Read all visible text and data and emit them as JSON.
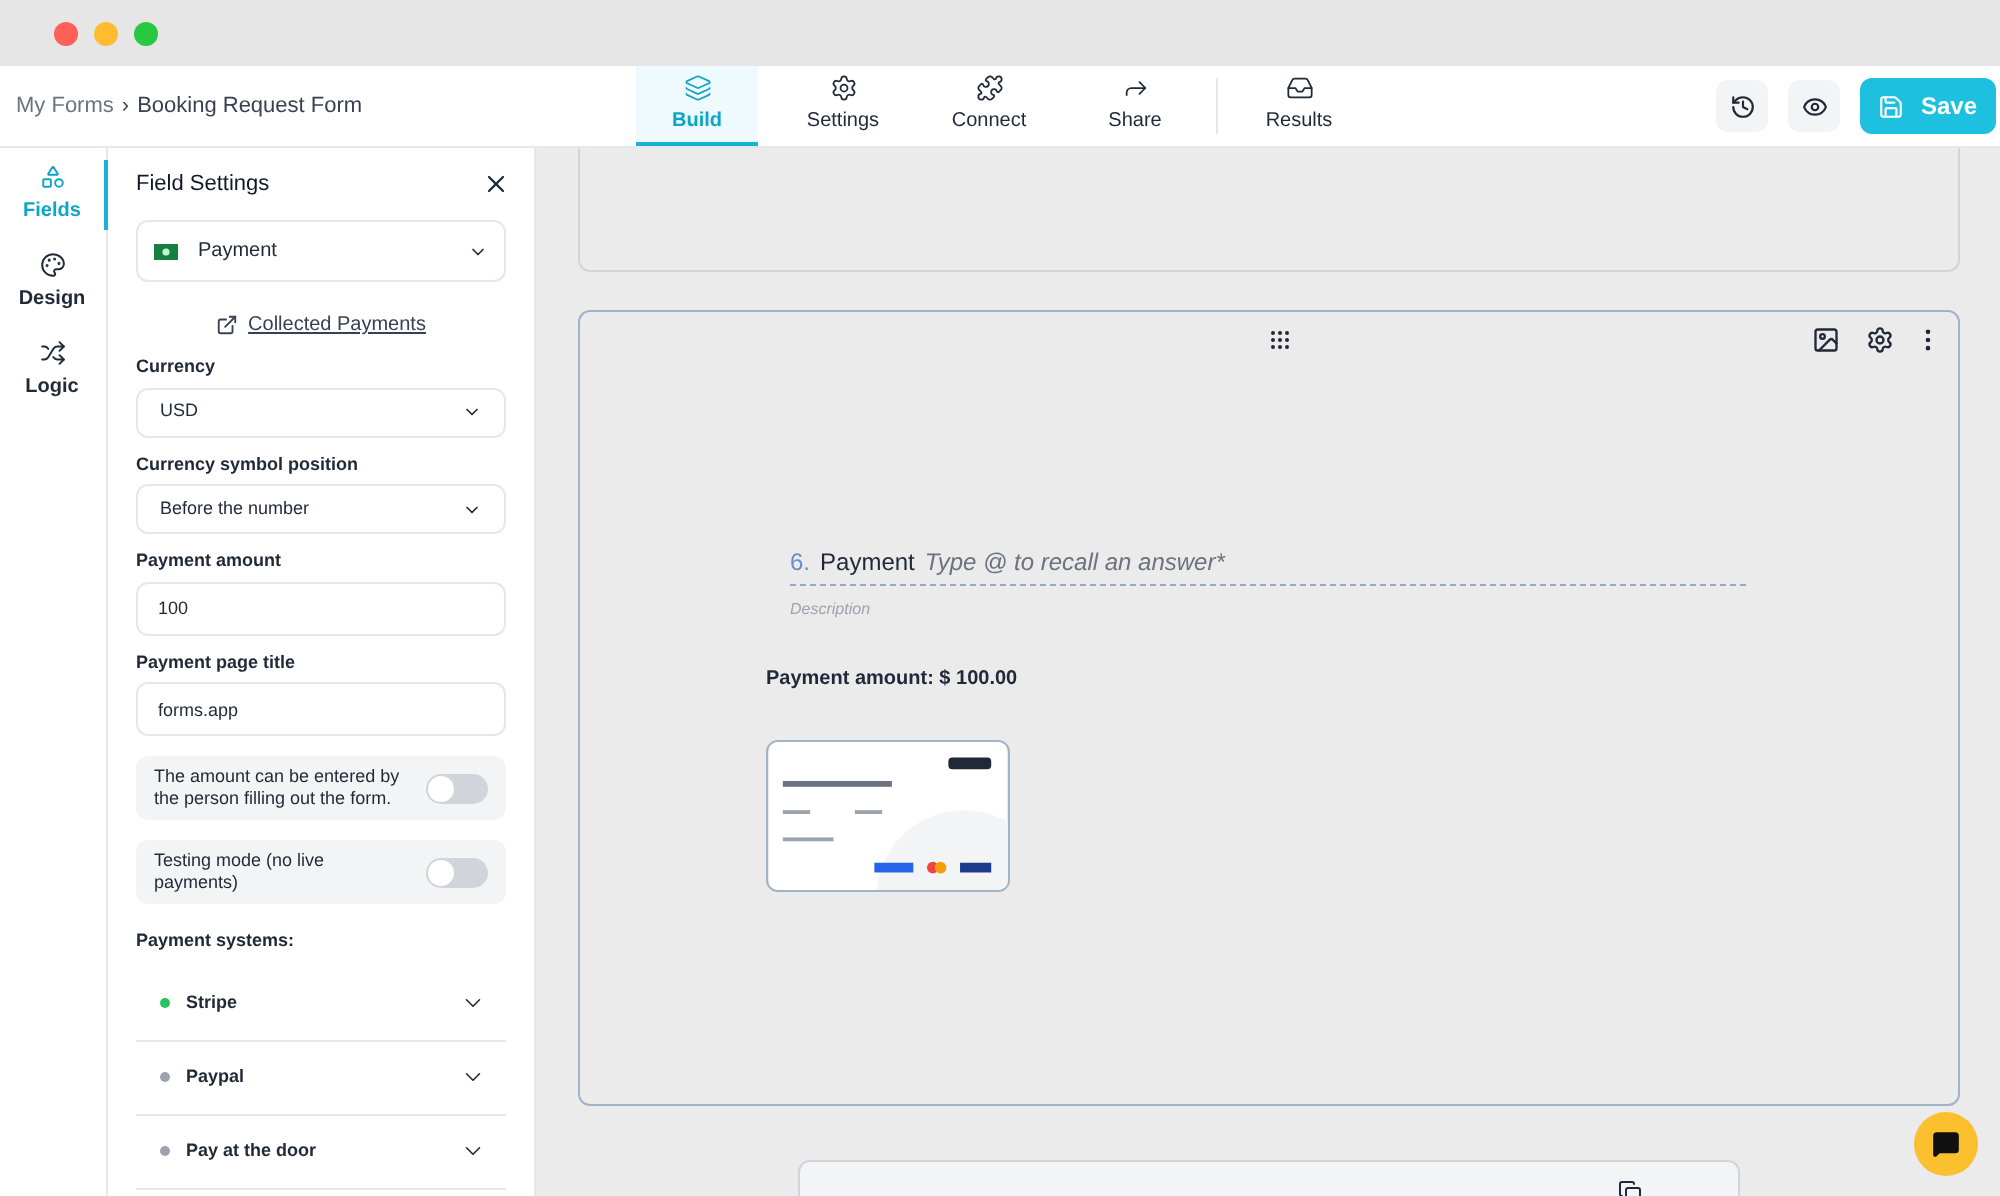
{
  "breadcrumb": {
    "parent": "My Forms",
    "separator": "›",
    "current": "Booking Request Form"
  },
  "tabs": [
    {
      "label": "Build",
      "selected": true
    },
    {
      "label": "Settings",
      "selected": false
    },
    {
      "label": "Connect",
      "selected": false
    },
    {
      "label": "Share",
      "selected": false
    },
    {
      "label": "Results",
      "selected": false
    }
  ],
  "save_button": "Save",
  "rail": [
    {
      "label": "Fields",
      "selected": true
    },
    {
      "label": "Design",
      "selected": false
    },
    {
      "label": "Logic",
      "selected": false
    }
  ],
  "panel": {
    "title": "Field Settings",
    "field_type": "Payment",
    "link": "Collected Payments",
    "fields": [
      {
        "kind": "select",
        "label": "Currency",
        "value": "USD"
      },
      {
        "kind": "select",
        "label": "Currency symbol position",
        "value": "Before the number"
      },
      {
        "kind": "input",
        "label": "Payment amount",
        "value": "100"
      },
      {
        "kind": "input",
        "label": "Payment page title",
        "value": "forms.app"
      }
    ],
    "toggles": [
      {
        "label": "The amount can be entered by the person filling out the form.",
        "on": false
      },
      {
        "label": "Testing mode (no live payments)",
        "on": false
      }
    ],
    "systems_heading": "Payment systems:",
    "systems": [
      {
        "name": "Stripe",
        "color": "#22c55e"
      },
      {
        "name": "Paypal",
        "color": "#9ca3af"
      },
      {
        "name": "Pay at the door",
        "color": "#9ca3af"
      }
    ]
  },
  "question": {
    "number": "6.",
    "title": "Payment",
    "placeholder": "Type @ to recall an answer*",
    "description": {
      "placeholder": "Description"
    },
    "amount": "Payment amount: $ 100.00"
  }
}
